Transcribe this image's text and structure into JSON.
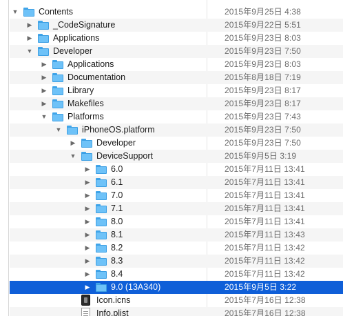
{
  "rows": [
    {
      "name": "Contents",
      "date": "2015年9月25日 4:38",
      "level": 0,
      "type": "folder",
      "disclosure": "open"
    },
    {
      "name": "_CodeSignature",
      "date": "2015年9月22日 5:51",
      "level": 1,
      "type": "folder",
      "disclosure": "closed"
    },
    {
      "name": "Applications",
      "date": "2015年9月23日 8:03",
      "level": 1,
      "type": "folder",
      "disclosure": "closed"
    },
    {
      "name": "Developer",
      "date": "2015年9月23日 7:50",
      "level": 1,
      "type": "folder",
      "disclosure": "open"
    },
    {
      "name": "Applications",
      "date": "2015年9月23日 8:03",
      "level": 2,
      "type": "folder",
      "disclosure": "closed"
    },
    {
      "name": "Documentation",
      "date": "2015年8月18日 7:19",
      "level": 2,
      "type": "folder",
      "disclosure": "closed"
    },
    {
      "name": "Library",
      "date": "2015年9月23日 8:17",
      "level": 2,
      "type": "folder",
      "disclosure": "closed"
    },
    {
      "name": "Makefiles",
      "date": "2015年9月23日 8:17",
      "level": 2,
      "type": "folder",
      "disclosure": "closed"
    },
    {
      "name": "Platforms",
      "date": "2015年9月23日 7:43",
      "level": 2,
      "type": "folder",
      "disclosure": "open"
    },
    {
      "name": "iPhoneOS.platform",
      "date": "2015年9月23日 7:50",
      "level": 3,
      "type": "folder",
      "disclosure": "open"
    },
    {
      "name": "Developer",
      "date": "2015年9月23日 7:50",
      "level": 4,
      "type": "folder",
      "disclosure": "closed"
    },
    {
      "name": "DeviceSupport",
      "date": "2015年9月5日 3:19",
      "level": 4,
      "type": "folder",
      "disclosure": "open"
    },
    {
      "name": "6.0",
      "date": "2015年7月11日 13:41",
      "level": 5,
      "type": "folder",
      "disclosure": "closed"
    },
    {
      "name": "6.1",
      "date": "2015年7月11日 13:41",
      "level": 5,
      "type": "folder",
      "disclosure": "closed"
    },
    {
      "name": "7.0",
      "date": "2015年7月11日 13:41",
      "level": 5,
      "type": "folder",
      "disclosure": "closed"
    },
    {
      "name": "7.1",
      "date": "2015年7月11日 13:41",
      "level": 5,
      "type": "folder",
      "disclosure": "closed"
    },
    {
      "name": "8.0",
      "date": "2015年7月11日 13:41",
      "level": 5,
      "type": "folder",
      "disclosure": "closed"
    },
    {
      "name": "8.1",
      "date": "2015年7月11日 13:43",
      "level": 5,
      "type": "folder",
      "disclosure": "closed"
    },
    {
      "name": "8.2",
      "date": "2015年7月11日 13:42",
      "level": 5,
      "type": "folder",
      "disclosure": "closed"
    },
    {
      "name": "8.3",
      "date": "2015年7月11日 13:42",
      "level": 5,
      "type": "folder",
      "disclosure": "closed"
    },
    {
      "name": "8.4",
      "date": "2015年7月11日 13:42",
      "level": 5,
      "type": "folder",
      "disclosure": "closed"
    },
    {
      "name": "9.0 (13A340)",
      "date": "2015年9月5日 3:22",
      "level": 5,
      "type": "folder",
      "disclosure": "closed",
      "selected": true
    },
    {
      "name": "Icon.icns",
      "date": "2015年7月16日 12:38",
      "level": 4,
      "type": "icns",
      "disclosure": "none"
    },
    {
      "name": "Info.plist",
      "date": "2015年7月16日 12:38",
      "level": 4,
      "type": "plist",
      "disclosure": "none"
    }
  ],
  "colors": {
    "selection": "#0f5fd8",
    "folder": "#6ec2f8"
  },
  "icons": {
    "open": "disclosure-triangle-open-icon",
    "closed": "disclosure-triangle-closed-icon",
    "folder": "folder-icon",
    "icns": "icns-file-icon",
    "plist": "plist-file-icon"
  }
}
